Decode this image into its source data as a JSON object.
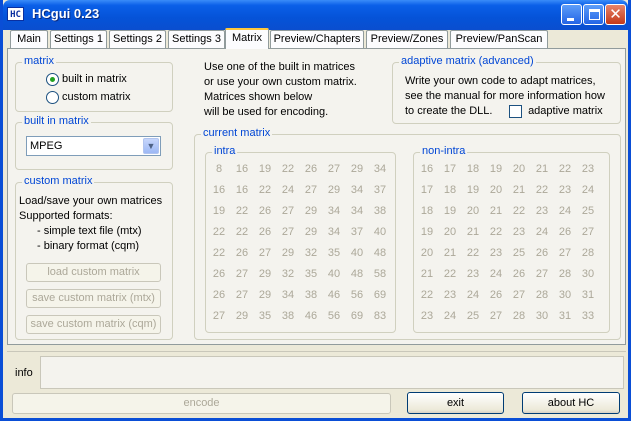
{
  "window": {
    "title": "HCgui 0.23",
    "icon_text": "HC"
  },
  "tabs": [
    {
      "label": "Main"
    },
    {
      "label": "Settings 1"
    },
    {
      "label": "Settings 2"
    },
    {
      "label": "Settings 3"
    },
    {
      "label": "Matrix"
    },
    {
      "label": "Preview/Chapters"
    },
    {
      "label": "Preview/Zones"
    },
    {
      "label": "Preview/PanScan"
    }
  ],
  "active_tab": "Matrix",
  "matrix_group": {
    "label": "matrix",
    "options": [
      {
        "label": "built in matrix",
        "checked": true
      },
      {
        "label": "custom matrix",
        "checked": false
      }
    ]
  },
  "info_text": {
    "lines": [
      "Use one of the built in matrices",
      "or use your own custom matrix.",
      "Matrices shown below",
      "will be used for encoding."
    ]
  },
  "adaptive_group": {
    "label": "adaptive matrix (advanced)",
    "lines": [
      "Write your own code to adapt matrices,",
      "see the manual for more information how",
      "to create the DLL."
    ],
    "checkbox_label": "adaptive matrix",
    "checked": false
  },
  "builtin_group": {
    "label": "built in matrix",
    "selected": "MPEG"
  },
  "custom_group": {
    "label": "custom matrix",
    "lines": [
      "Load/save your own matrices",
      "Supported formats:",
      "- simple text file (mtx)",
      "- binary format (cqm)"
    ],
    "buttons": [
      {
        "label": "load custom matrix"
      },
      {
        "label": "save custom matrix (mtx)"
      },
      {
        "label": "save custom matrix (cqm)"
      }
    ]
  },
  "current_matrix": {
    "label": "current matrix",
    "intra": {
      "label": "intra",
      "rows": [
        [
          8,
          16,
          19,
          22,
          26,
          27,
          29,
          34
        ],
        [
          16,
          16,
          22,
          24,
          27,
          29,
          34,
          37
        ],
        [
          19,
          22,
          26,
          27,
          29,
          34,
          34,
          38
        ],
        [
          22,
          22,
          26,
          27,
          29,
          34,
          37,
          40
        ],
        [
          22,
          26,
          27,
          29,
          32,
          35,
          40,
          48
        ],
        [
          26,
          27,
          29,
          32,
          35,
          40,
          48,
          58
        ],
        [
          26,
          27,
          29,
          34,
          38,
          46,
          56,
          69
        ],
        [
          27,
          29,
          35,
          38,
          46,
          56,
          69,
          83
        ]
      ]
    },
    "non_intra": {
      "label": "non-intra",
      "rows": [
        [
          16,
          17,
          18,
          19,
          20,
          21,
          22,
          23
        ],
        [
          17,
          18,
          19,
          20,
          21,
          22,
          23,
          24
        ],
        [
          18,
          19,
          20,
          21,
          22,
          23,
          24,
          25
        ],
        [
          19,
          20,
          21,
          22,
          23,
          24,
          26,
          27
        ],
        [
          20,
          21,
          22,
          23,
          25,
          26,
          27,
          28
        ],
        [
          21,
          22,
          23,
          24,
          26,
          27,
          28,
          30
        ],
        [
          22,
          23,
          24,
          26,
          27,
          28,
          30,
          31
        ],
        [
          23,
          24,
          25,
          27,
          28,
          30,
          31,
          33
        ]
      ]
    }
  },
  "info_bar": {
    "label": "info",
    "value": ""
  },
  "footer": {
    "encode_label": "encode",
    "exit_label": "exit",
    "about_label": "about HC"
  }
}
